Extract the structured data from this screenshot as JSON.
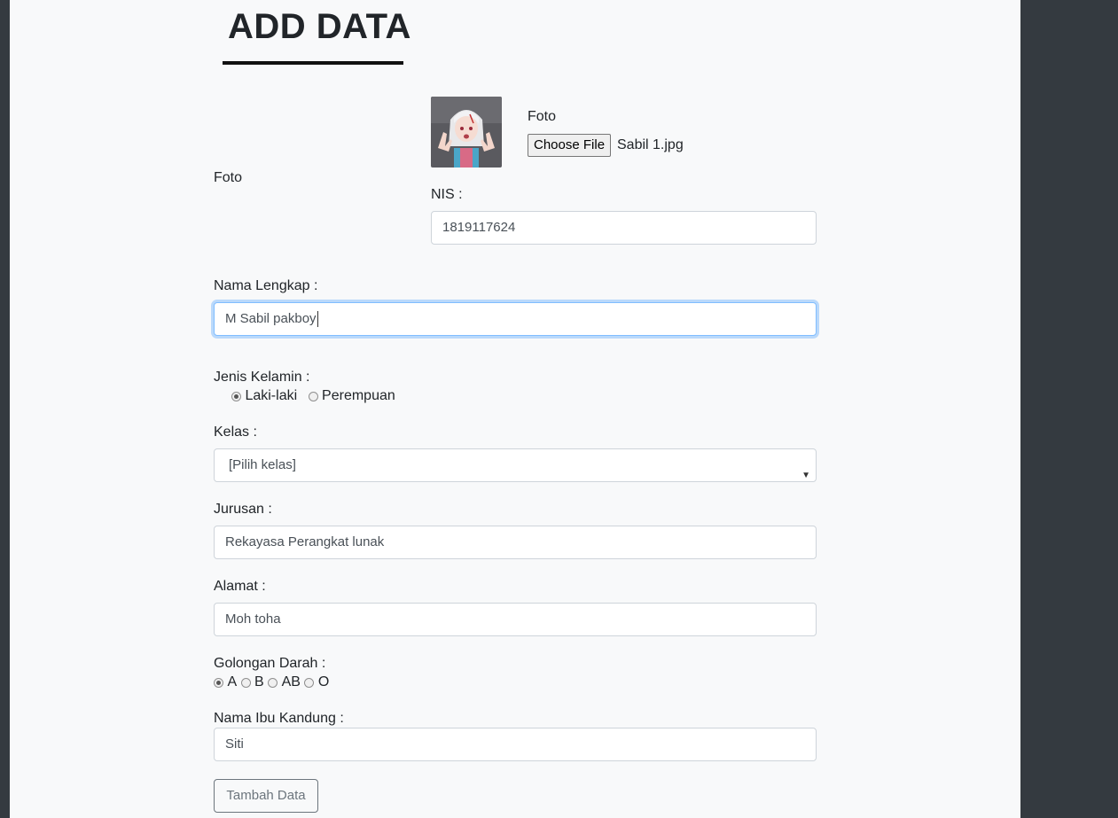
{
  "page": {
    "title": "ADD DATA"
  },
  "form": {
    "foto_label_left": "Foto",
    "foto_label_right": "Foto",
    "file": {
      "button_label": "Choose File",
      "file_name": "Sabil 1.jpg"
    },
    "nis": {
      "label": "NIS :",
      "value": "1819117624"
    },
    "nama": {
      "label": "Nama Lengkap :",
      "value": "M Sabil pakboy"
    },
    "jenis_kelamin": {
      "label": "Jenis Kelamin :",
      "options": [
        {
          "label": "Laki-laki",
          "checked": true
        },
        {
          "label": "Perempuan",
          "checked": false
        }
      ]
    },
    "kelas": {
      "label": "Kelas :",
      "selected": "[Pilih kelas]"
    },
    "jurusan": {
      "label": "Jurusan :",
      "value": "Rekayasa Perangkat lunak"
    },
    "alamat": {
      "label": "Alamat :",
      "value": "Moh toha"
    },
    "golongan_darah": {
      "label": "Golongan Darah :",
      "options": [
        {
          "label": "A",
          "checked": true
        },
        {
          "label": "B",
          "checked": false
        },
        {
          "label": "AB",
          "checked": false
        },
        {
          "label": "O",
          "checked": false
        }
      ]
    },
    "ibu": {
      "label": "Nama Ibu Kandung :",
      "value": "Siti"
    },
    "submit_label": "Tambah Data"
  },
  "colors": {
    "background": "#f8f9fa",
    "sidebar": "#343a40",
    "focus": "#80bdff"
  }
}
